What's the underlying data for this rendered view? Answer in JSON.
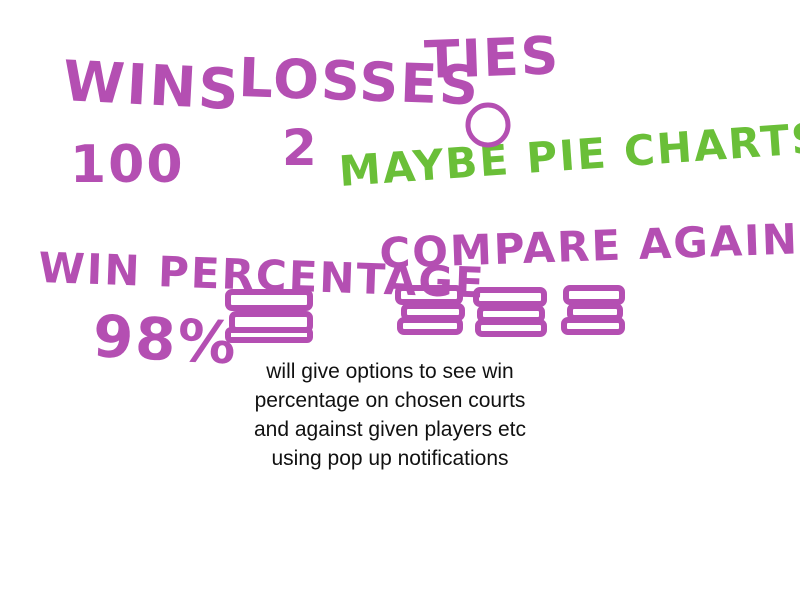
{
  "colors": {
    "ink": "#b44fb2",
    "green": "#6abf38",
    "text": "#111111"
  },
  "stats": {
    "wins_label": "WINS",
    "losses_label": "LOSSES",
    "ties_label": "TIES",
    "wins_value": "100",
    "losses_value": "2"
  },
  "idea_note": "MAYBE PIE CHARTS??",
  "win_percentage": {
    "label": "WIN PERCENTAGE",
    "value": "98%"
  },
  "compare": {
    "label": "COMPARE AGAINST:"
  },
  "description": {
    "lines": [
      "will give options to see win",
      "percentage on chosen courts",
      "and against given players etc",
      "using pop up notifications"
    ]
  }
}
